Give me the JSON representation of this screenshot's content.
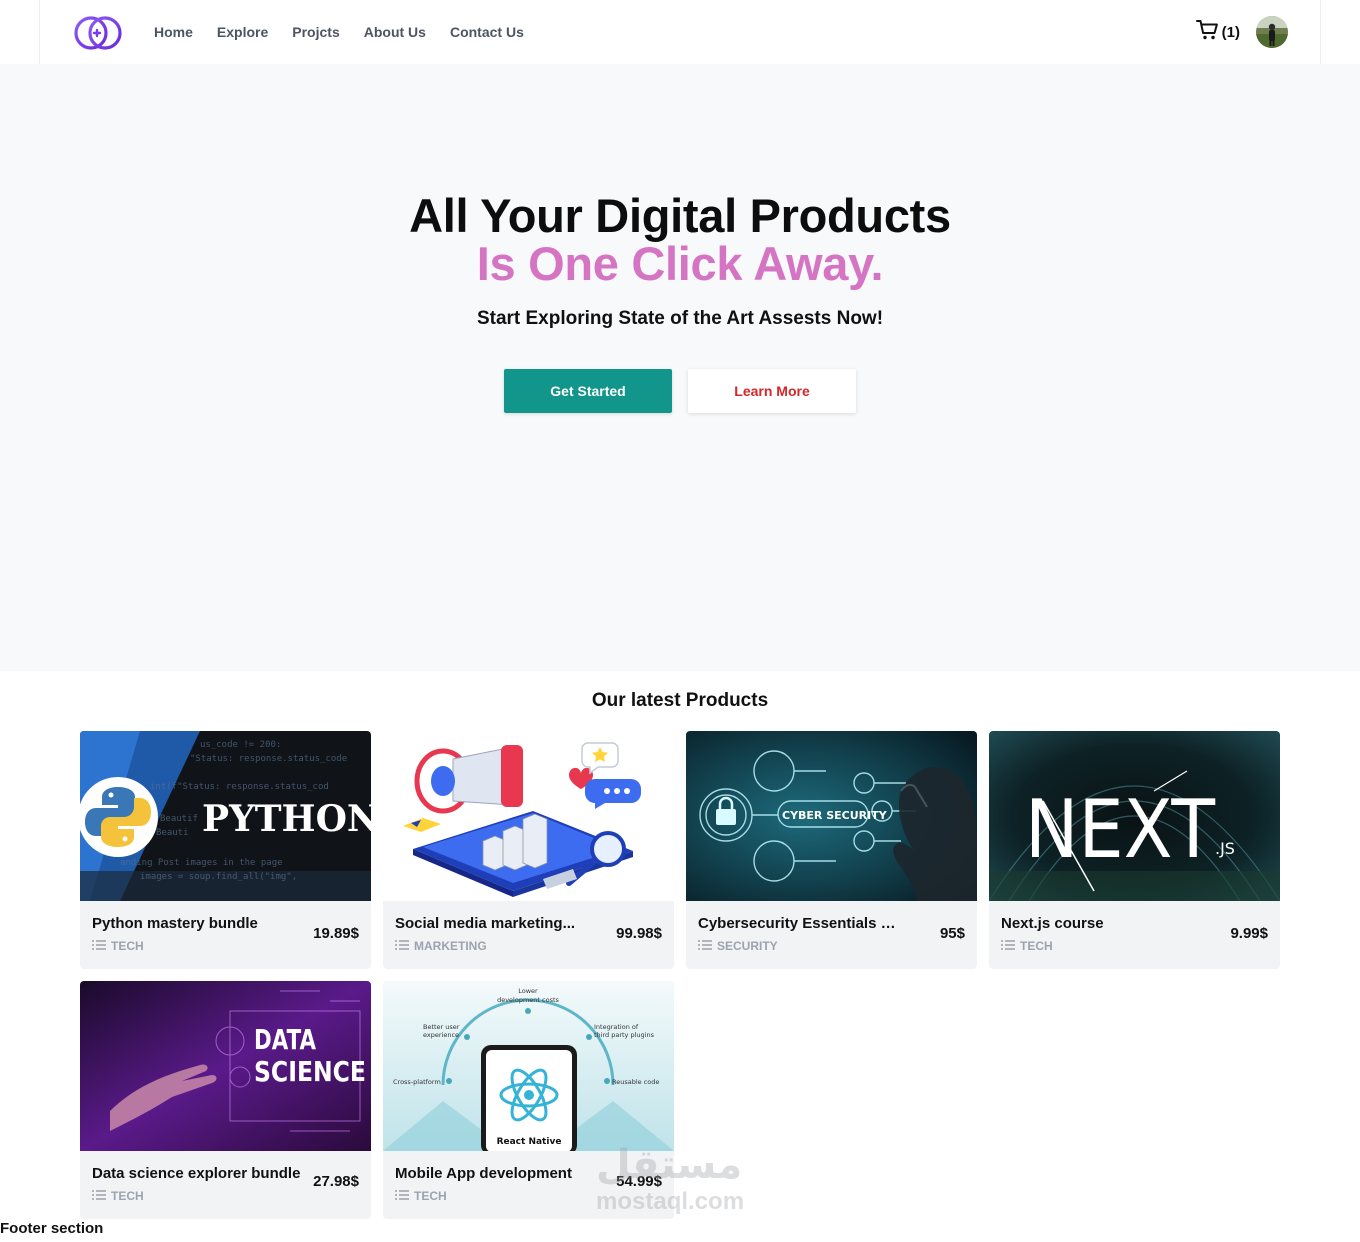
{
  "nav": {
    "links": [
      "Home",
      "Explore",
      "Projcts",
      "About Us",
      "Contact Us"
    ],
    "cart_count": "(1)"
  },
  "hero": {
    "title": "All Your Digital Products",
    "title_accent": "Is One Click Away.",
    "subtitle": "Start Exploring State of the Art Assests Now!",
    "primary_button": "Get Started",
    "secondary_button": "Learn More"
  },
  "products": {
    "section_title": "Our latest Products",
    "items": [
      {
        "name": "Python mastery bundle",
        "category": "TECH",
        "price": "19.89$",
        "image_text": "PYTHON"
      },
      {
        "name": "Social media marketing...",
        "category": "MARKETING",
        "price": "99.98$",
        "image_text": ""
      },
      {
        "name": "Cybersecurity Essentials kit",
        "category": "SECURITY",
        "price": "95$",
        "image_text": "CYBER SECURITY"
      },
      {
        "name": "Next.js course",
        "category": "TECH",
        "price": "9.99$",
        "image_text": "NEXT"
      },
      {
        "name": "Data science explorer bundle",
        "category": "TECH",
        "price": "27.98$",
        "image_text": "DATA SCIENCE"
      },
      {
        "name": "Mobile App development",
        "category": "TECH",
        "price": "54.99$",
        "image_text": "React Native"
      }
    ],
    "image_labels": {
      "js_suffix": ".JS",
      "data": "DATA",
      "science": "SCIENCE",
      "rn_lower": "Lower",
      "rn_lower2": "development costs",
      "rn_better": "Better user",
      "rn_better2": "experience",
      "rn_integration": "Integration of",
      "rn_integration2": "third party plugins",
      "rn_cross": "Cross-platform",
      "rn_reusable": "Reusable code"
    }
  },
  "footer": {
    "text": "Footer section"
  },
  "watermark": {
    "arabic": "مستقل",
    "latin": "mostaql.com"
  },
  "colors": {
    "accent_pink": "#d674c4",
    "primary_teal": "#12958a",
    "secondary_red": "#d3272a",
    "logo_purple": "#7c3aed"
  }
}
